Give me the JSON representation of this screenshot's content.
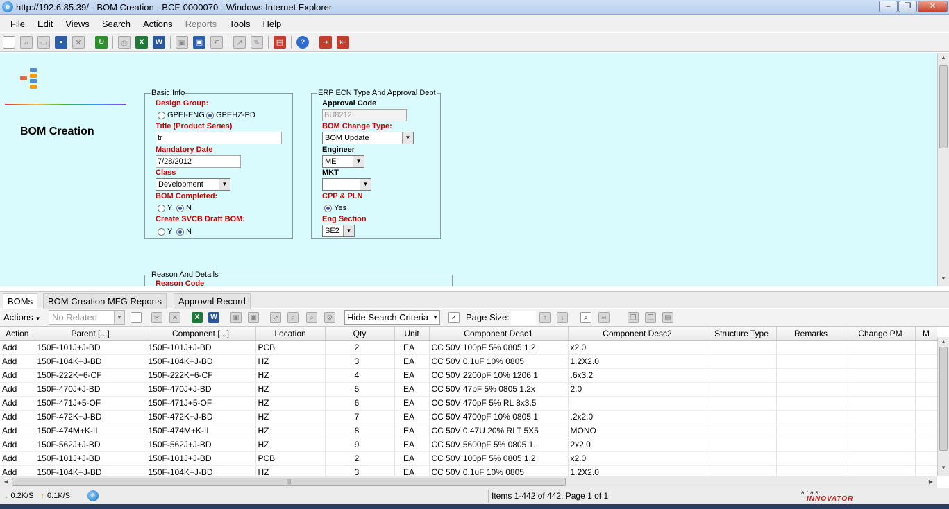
{
  "window": {
    "title": "http://192.6.85.39/ - BOM Creation - BCF-0000070 - Windows Internet Explorer"
  },
  "menu": [
    "File",
    "Edit",
    "Views",
    "Search",
    "Actions",
    "Reports",
    "Tools",
    "Help"
  ],
  "form": {
    "page_title": "BOM Creation",
    "basic_info": {
      "legend": "Basic Info",
      "design_group_label": "Design Group:",
      "design_group_options": [
        "GPEI-ENG",
        "GPEHZ-PD"
      ],
      "design_group_selected": "GPEHZ-PD",
      "title_label": "Title (Product Series)",
      "title_value": "tr",
      "mandatory_date_label": "Mandatory Date",
      "mandatory_date_value": "7/28/2012",
      "class_label": "Class",
      "class_value": "Development",
      "bom_completed_label": "BOM Completed:",
      "bom_completed_yes": "Y",
      "bom_completed_no": "N",
      "create_svcb_label": "Create SVCB Draft BOM:",
      "create_svcb_yes": "Y",
      "create_svcb_no": "N"
    },
    "erp": {
      "legend": "ERP ECN Type And Approval Dept",
      "approval_code_label": "Approval Code",
      "approval_code_value": "BU8212",
      "bom_change_type_label": "BOM Change Type:",
      "bom_change_type_value": "BOM Update",
      "engineer_label": "Engineer",
      "engineer_value": "ME",
      "mkt_label": "MKT",
      "mkt_value": "",
      "cpp_pln_label": "CPP & PLN",
      "cpp_pln_option": "Yes",
      "eng_section_label": "Eng Section",
      "eng_section_value": "SE2"
    },
    "reason": {
      "legend": "Reason And Details",
      "reason_code_label": "Reason Code"
    }
  },
  "tabs": [
    "BOMs",
    "BOM Creation MFG Reports",
    "Approval Record"
  ],
  "grid_toolbar": {
    "actions_label": "Actions",
    "related_placeholder": "No Related",
    "hide_search_label": "Hide Search Criteria",
    "page_size_label": "Page Size:"
  },
  "grid": {
    "columns": [
      "Action",
      "Parent [...]",
      "Component [...]",
      "Location",
      "Qty",
      "Unit",
      "Component Desc1",
      "Component Desc2",
      "Structure Type",
      "Remarks",
      "Change PM",
      "M"
    ],
    "rows": [
      [
        "Add",
        "150F-101J+J-BD",
        "150F-101J+J-BD",
        "PCB",
        "2",
        "EA",
        "CC 50V 100pF 5% 0805 1.2",
        "x2.0",
        "",
        "",
        "",
        ""
      ],
      [
        "Add",
        "150F-104K+J-BD",
        "150F-104K+J-BD",
        "HZ",
        "3",
        "EA",
        "CC 50V 0.1uF 10% 0805",
        "1.2X2.0",
        "",
        "",
        "",
        ""
      ],
      [
        "Add",
        "150F-222K+6-CF",
        "150F-222K+6-CF",
        "HZ",
        "4",
        "EA",
        "CC 50V 2200pF 10% 1206 1",
        ".6x3.2",
        "",
        "",
        "",
        ""
      ],
      [
        "Add",
        "150F-470J+J-BD",
        "150F-470J+J-BD",
        "HZ",
        "5",
        "EA",
        "CC 50V 47pF 5% 0805 1.2x",
        "2.0",
        "",
        "",
        "",
        ""
      ],
      [
        "Add",
        "150F-471J+5-OF",
        "150F-471J+5-OF",
        "HZ",
        "6",
        "EA",
        "CC 50V 470pF 5% RL 8x3.5",
        "",
        "",
        "",
        "",
        ""
      ],
      [
        "Add",
        "150F-472K+J-BD",
        "150F-472K+J-BD",
        "HZ",
        "7",
        "EA",
        "CC 50V 4700pF 10% 0805 1",
        ".2x2.0",
        "",
        "",
        "",
        ""
      ],
      [
        "Add",
        "150F-474M+K-II",
        "150F-474M+K-II",
        "HZ",
        "8",
        "EA",
        "CC 50V 0.47U 20% RLT 5X5",
        "MONO",
        "",
        "",
        "",
        ""
      ],
      [
        "Add",
        "150F-562J+J-BD",
        "150F-562J+J-BD",
        "HZ",
        "9",
        "EA",
        "CC 50V 5600pF 5% 0805 1.",
        "2x2.0",
        "",
        "",
        "",
        ""
      ],
      [
        "Add",
        "150F-101J+J-BD",
        "150F-101J+J-BD",
        "PCB",
        "2",
        "EA",
        "CC 50V 100pF 5% 0805 1.2",
        "x2.0",
        "",
        "",
        "",
        ""
      ],
      [
        "Add",
        "150F-104K+J-BD",
        "150F-104K+J-BD",
        "HZ",
        "3",
        "EA",
        "CC 50V 0.1uF 10% 0805",
        "1.2X2.0",
        "",
        "",
        "",
        ""
      ]
    ]
  },
  "statusbar": {
    "download": "0.2K/S",
    "upload": "0.1K/S",
    "items": "Items 1-442 of 442. Page 1 of 1",
    "brand_top": "aras",
    "brand": "INNOVATOR"
  }
}
